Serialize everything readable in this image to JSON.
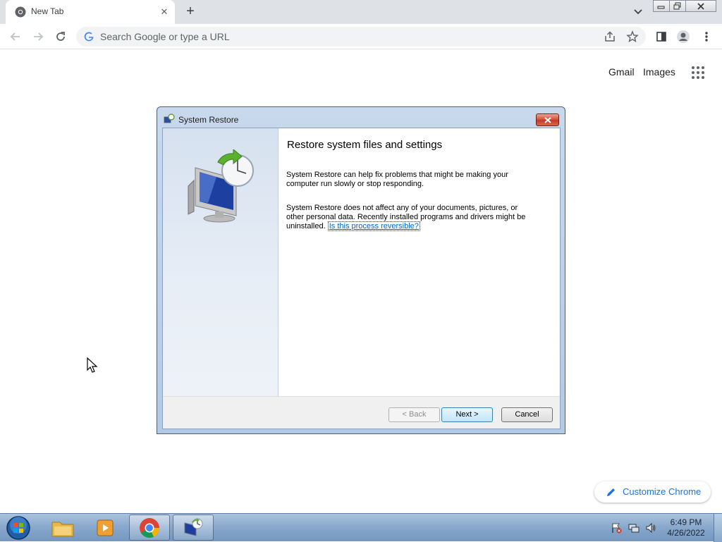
{
  "browser": {
    "tab_title": "New Tab",
    "omnibox_placeholder": "Search Google or type a URL",
    "links": {
      "gmail": "Gmail",
      "images": "Images"
    },
    "customize_label": "Customize Chrome"
  },
  "dialog": {
    "title": "System Restore",
    "heading": "Restore system files and settings",
    "paragraph1": "System Restore can help fix problems that might be making your computer run slowly or stop responding.",
    "paragraph2": "System Restore does not affect any of your documents, pictures, or other personal data. Recently installed programs and drivers might be uninstalled.",
    "link": "Is this process reversible?",
    "buttons": {
      "back": "< Back",
      "next": "Next >",
      "cancel": "Cancel"
    }
  },
  "taskbar": {
    "time": "6:49 PM",
    "date": "4/26/2022",
    "items": [
      "start-orb",
      "explorer",
      "media-player",
      "chrome",
      "system-restore"
    ]
  },
  "colors": {
    "accent": "#1a73e8",
    "link": "#0066cc",
    "taskbar": "#87a7cb"
  }
}
